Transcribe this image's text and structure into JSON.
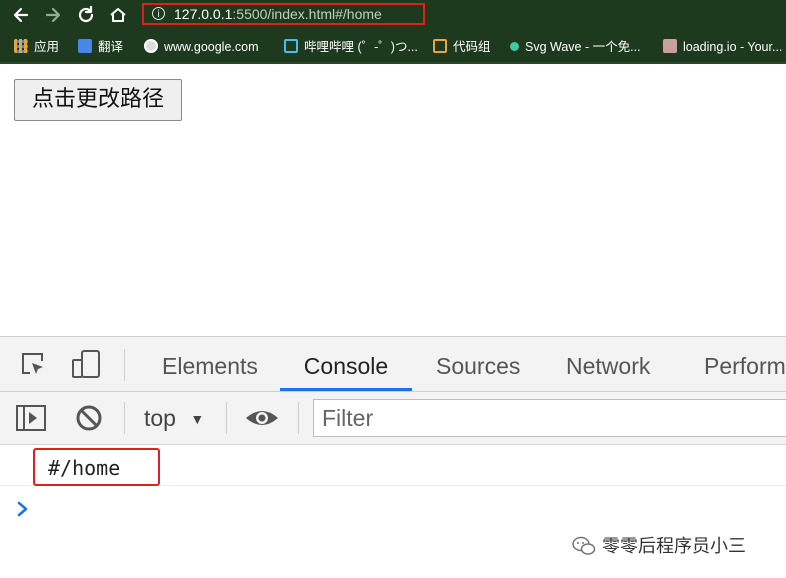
{
  "browser": {
    "toolbar": {
      "back_icon": "arrow-left-icon",
      "forward_icon": "arrow-right-icon",
      "reload_icon": "reload-icon",
      "home_icon": "home-icon",
      "url_host": "127.0.0.1",
      "url_rest": ":5500/index.html#/home"
    },
    "bookmarks": [
      {
        "label": "应用",
        "icon": "apps-grid-icon"
      },
      {
        "label": "翻译",
        "icon": "translate-icon"
      },
      {
        "label": "www.google.com",
        "icon": "globe-icon"
      },
      {
        "label": "哔哩哔哩 (゜-゜)つ...",
        "icon": "bilibili-icon"
      },
      {
        "label": "代码组",
        "icon": "code-icon"
      },
      {
        "label": "Svg Wave - 一个免...",
        "icon": "svgwave-icon"
      },
      {
        "label": "loading.io - Your...",
        "icon": "loadingio-icon"
      }
    ]
  },
  "page": {
    "button_label": "点击更改路径"
  },
  "devtools": {
    "tabs": [
      "Elements",
      "Console",
      "Sources",
      "Network",
      "Perform"
    ],
    "active_tab": "Console",
    "console": {
      "context": "top",
      "filter_placeholder": "Filter",
      "log_lines": [
        "#/home"
      ]
    }
  },
  "watermark": "零零后程序员小三",
  "colors": {
    "chrome_dark": "#1e3a1e",
    "highlight_red": "#e0201a",
    "devtools_blue": "#1a73e8"
  }
}
